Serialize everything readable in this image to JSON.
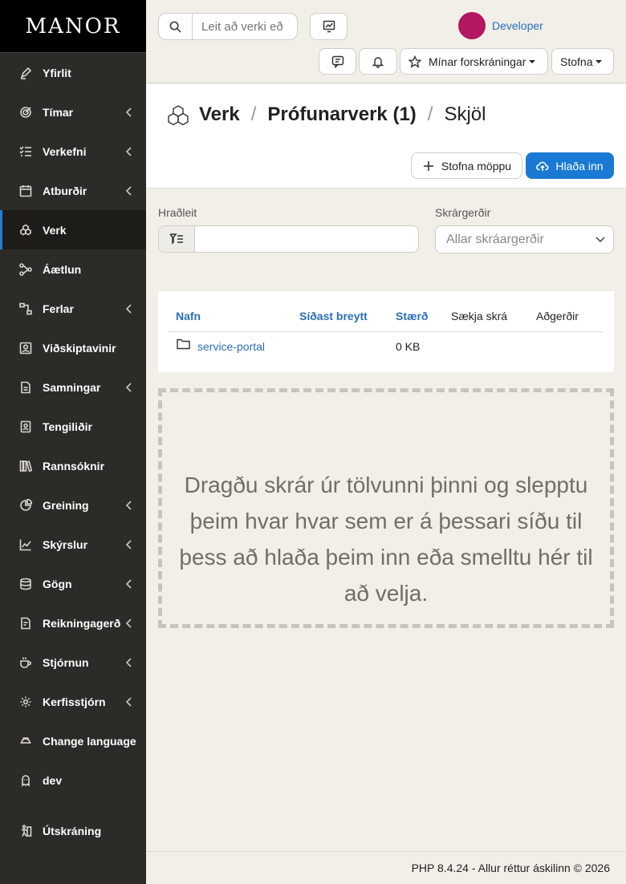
{
  "brand": "MANOR",
  "sidebar": {
    "items": [
      {
        "label": "Yfirlit",
        "icon": "pen-icon",
        "submenu": false,
        "active": false
      },
      {
        "label": "Tímar",
        "icon": "target-icon",
        "submenu": true,
        "active": false
      },
      {
        "label": "Verkefni",
        "icon": "checklist-icon",
        "submenu": true,
        "active": false
      },
      {
        "label": "Atburðir",
        "icon": "calendar-icon",
        "submenu": true,
        "active": false
      },
      {
        "label": "Verk",
        "icon": "boxes-icon",
        "submenu": false,
        "active": true
      },
      {
        "label": "Áætlun",
        "icon": "network-icon",
        "submenu": false,
        "active": false
      },
      {
        "label": "Ferlar",
        "icon": "process-icon",
        "submenu": true,
        "active": false
      },
      {
        "label": "Viðskiptavinir",
        "icon": "user-card-icon",
        "submenu": false,
        "active": false
      },
      {
        "label": "Samningar",
        "icon": "document-icon",
        "submenu": true,
        "active": false
      },
      {
        "label": "Tengiliðir",
        "icon": "contact-icon",
        "submenu": false,
        "active": false
      },
      {
        "label": "Rannsóknir",
        "icon": "books-icon",
        "submenu": false,
        "active": false
      },
      {
        "label": "Greining",
        "icon": "pie-chart-icon",
        "submenu": true,
        "active": false
      },
      {
        "label": "Skýrslur",
        "icon": "line-chart-icon",
        "submenu": true,
        "active": false
      },
      {
        "label": "Gögn",
        "icon": "database-icon",
        "submenu": true,
        "active": false
      },
      {
        "label": "Reikningagerð",
        "icon": "invoice-icon",
        "submenu": true,
        "active": false
      },
      {
        "label": "Stjórnun",
        "icon": "coffee-icon",
        "submenu": true,
        "active": false
      },
      {
        "label": "Kerfisstjórn",
        "icon": "gear-icon",
        "submenu": true,
        "active": false
      },
      {
        "label": "Change language",
        "icon": "globe-icon",
        "submenu": false,
        "active": false
      },
      {
        "label": "dev",
        "icon": "ghost-icon",
        "submenu": false,
        "active": false
      },
      {
        "label": "Útskráning",
        "icon": "logout-icon",
        "submenu": false,
        "active": false
      }
    ]
  },
  "topbar": {
    "search_placeholder": "Leit að verki eð",
    "user_name": "Developer",
    "avatar_color": "#b2175f",
    "bookmarks_label": "Mínar forskráningar",
    "create_label": "Stofna"
  },
  "header": {
    "crumb_root": "Verk",
    "crumb_project": "Prófunarverk (1)",
    "crumb_current": "Skjöl",
    "sep": "/",
    "create_folder_label": "Stofna möppu",
    "upload_label": "Hlaða inn"
  },
  "filters": {
    "quick_search_label": "Hraðleit",
    "quick_search_value": "",
    "file_types_label": "Skrárgerðir",
    "file_types_placeholder": "Allar skráargerðir"
  },
  "table": {
    "headers": {
      "name": "Nafn",
      "modified": "Síðast breytt",
      "size": "Stærð",
      "download": "Sækja skrá",
      "actions": "Aðgerðir"
    },
    "rows": [
      {
        "name": "service-portal",
        "modified": "",
        "size": "0 KB"
      }
    ]
  },
  "dropzone": {
    "text": "Dragðu skrár úr tölvunni þinni og slepptu þeim hvar hvar sem er á þessari síðu til þess að hlaða þeim inn eða smelltu hér til að velja."
  },
  "footer": {
    "text": "PHP 8.4.24 - Allur réttur áskilinn © 2026"
  },
  "colors": {
    "accent": "#1a7ad3",
    "link": "#2a6fb8",
    "sidebar_bg": "#2c2b27"
  }
}
